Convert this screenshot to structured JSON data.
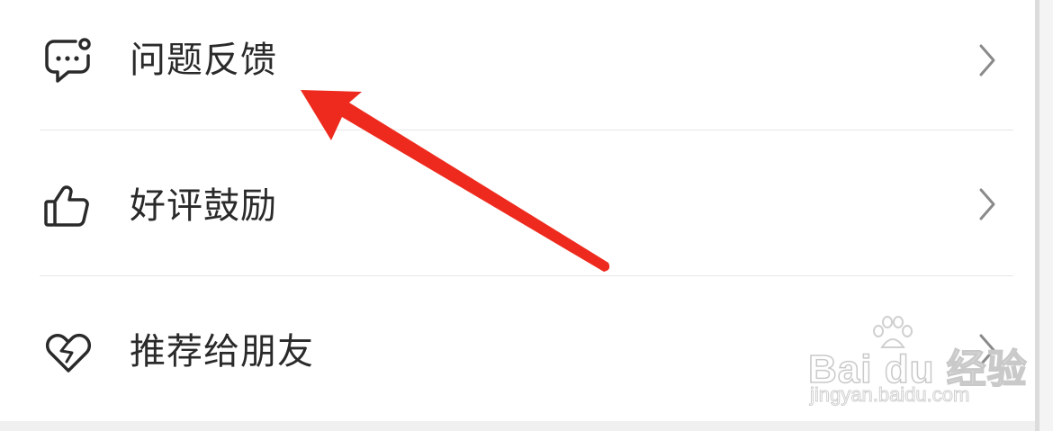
{
  "menu": {
    "items": [
      {
        "label": "问题反馈",
        "icon": "feedback-chat-icon"
      },
      {
        "label": "好评鼓励",
        "icon": "thumbs-up-icon"
      },
      {
        "label": "推荐给朋友",
        "icon": "heart-share-icon"
      }
    ],
    "chevron_icon": "chevron-right-icon"
  },
  "annotation": {
    "arrow_color": "#ee2a1e"
  },
  "watermark": {
    "brand": "Bai du 经验",
    "url": "jingyan.baidu.com"
  }
}
